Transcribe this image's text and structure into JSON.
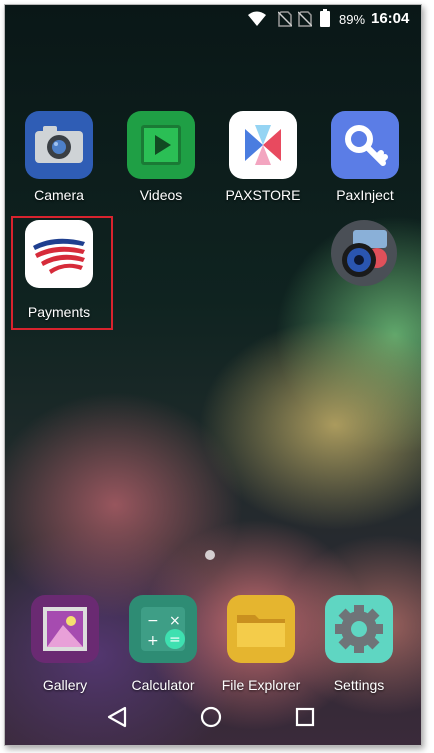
{
  "status": {
    "battery_pct": "89%",
    "time": "16:04"
  },
  "apps": [
    {
      "label": "Camera",
      "icon": "camera-icon"
    },
    {
      "label": "Videos",
      "icon": "play-icon"
    },
    {
      "label": "PAXSTORE",
      "icon": "paxstore-icon"
    },
    {
      "label": "PaxInject",
      "icon": "key-icon"
    },
    {
      "label": "Payments",
      "icon": "bank-flag-icon"
    },
    {
      "label": "",
      "icon": "speaker-icon"
    }
  ],
  "dock": [
    {
      "label": "Gallery",
      "icon": "gallery-icon"
    },
    {
      "label": "Calculator",
      "icon": "calculator-icon"
    },
    {
      "label": "File Explorer",
      "icon": "folder-icon"
    },
    {
      "label": "Settings",
      "icon": "gear-icon"
    }
  ],
  "nav": {
    "back": "back-icon",
    "home": "home-icon",
    "recents": "recents-icon"
  },
  "colors": {
    "highlight": "#d9232e",
    "camera": "#2f5db5",
    "videos": "#1f9f45",
    "paxinject": "#5b7de6",
    "calculator": "#2e8c74",
    "files": "#e5b52f",
    "settings": "#5fd6c2"
  }
}
